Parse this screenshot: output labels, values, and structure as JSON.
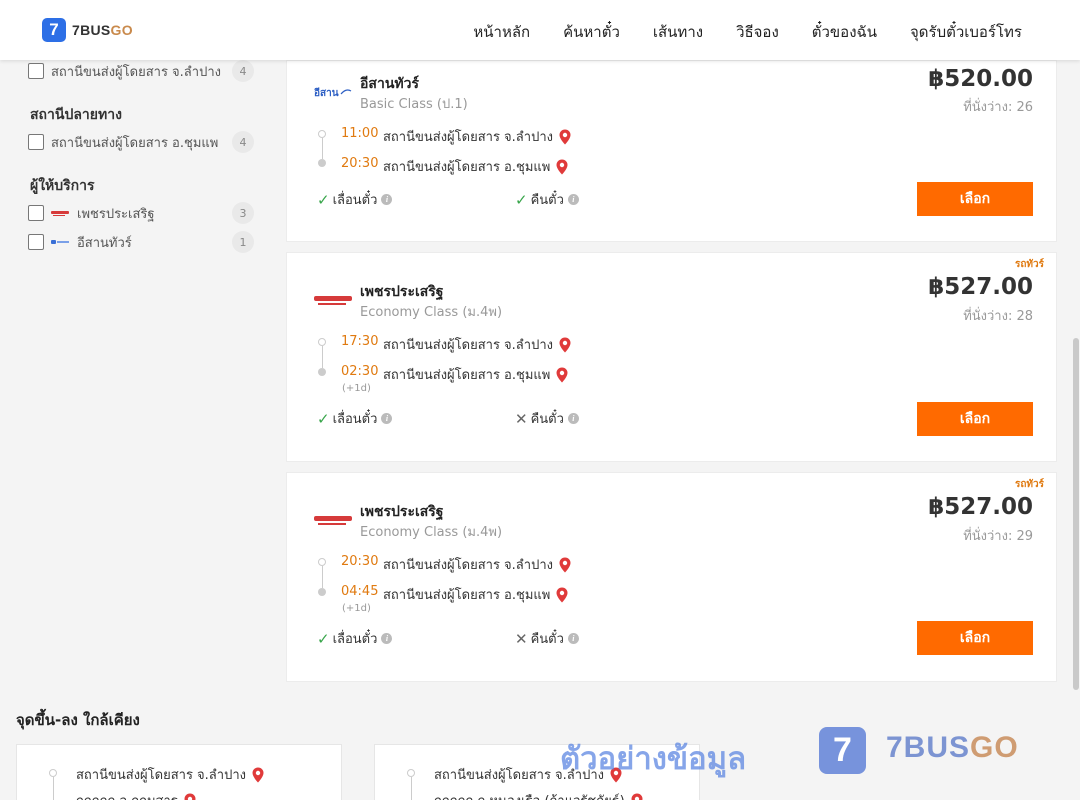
{
  "brand": {
    "logo_mark": "7",
    "name_main": "7BUS",
    "name_accent": "GO"
  },
  "nav": [
    "หน้าหลัก",
    "ค้นหาตั๋ว",
    "เส้นทาง",
    "วิธีจอง",
    "ตั๋วของฉัน",
    "จุดรับตั๋วเบอร์โทร"
  ],
  "sidebar": {
    "origin_item": {
      "label": "สถานีขนส่งผู้โดยสาร จ.ลำปาง",
      "count": "4"
    },
    "destination_title": "สถานีปลายทาง",
    "destination_item": {
      "label": "สถานีขนส่งผู้โดยสาร อ.ชุมแพ",
      "count": "4"
    },
    "operator_title": "ผู้ให้บริการ",
    "operators": [
      {
        "label": "เพชรประเสริฐ",
        "count": "3",
        "logo_color": "#d63a3a"
      },
      {
        "label": "อีสานทัวร์",
        "count": "1",
        "logo_color": "#3a6fd6"
      }
    ]
  },
  "trips": [
    {
      "operator": "อีสานทัวร์",
      "class": "Basic Class (ป.1)",
      "price": "฿520.00",
      "seats": "ที่นั่งว่าง: 26",
      "badge": "",
      "depart_time": "11:00",
      "depart_station": "สถานีขนส่งผู้โดยสาร จ.ลำปาง",
      "arrive_time": "20:30",
      "arrive_station": "สถานีขนส่งผู้โดยสาร อ.ชุมแพ",
      "next_day": "",
      "change_label": "เลื่อนตั๋ว",
      "change_allowed": true,
      "refund_label": "คืนตั๋ว",
      "refund_allowed": true,
      "button": "เลือก"
    },
    {
      "operator": "เพชรประเสริฐ",
      "class": "Economy Class (ม.4พ)",
      "price": "฿527.00",
      "seats": "ที่นั่งว่าง: 28",
      "badge": "รถทัวร์",
      "depart_time": "17:30",
      "depart_station": "สถานีขนส่งผู้โดยสาร จ.ลำปาง",
      "arrive_time": "02:30",
      "arrive_station": "สถานีขนส่งผู้โดยสาร อ.ชุมแพ",
      "next_day": "(+1d)",
      "change_label": "เลื่อนตั๋ว",
      "change_allowed": true,
      "refund_label": "คืนตั๋ว",
      "refund_allowed": false,
      "button": "เลือก"
    },
    {
      "operator": "เพชรประเสริฐ",
      "class": "Economy Class (ม.4พ)",
      "price": "฿527.00",
      "seats": "ที่นั่งว่าง: 29",
      "badge": "รถทัวร์",
      "depart_time": "20:30",
      "depart_station": "สถานีขนส่งผู้โดยสาร จ.ลำปาง",
      "arrive_time": "04:45",
      "arrive_station": "สถานีขนส่งผู้โดยสาร อ.ชุมแพ",
      "next_day": "(+1d)",
      "change_label": "เลื่อนตั๋ว",
      "change_allowed": true,
      "refund_label": "คืนตั๋ว",
      "refund_allowed": false,
      "button": "เลือก"
    }
  ],
  "icons": {
    "check": "check-icon",
    "cross": "cross-icon",
    "info": "info-icon",
    "pin": "map-pin-icon"
  },
  "nearby": {
    "title": "จุดขึ้น-ลง ใกล้เคียง",
    "cards": [
      {
        "from": "สถานีขนส่งผู้โดยสาร จ.ลำปาง",
        "to": "ถถถถถ จ.ถถมสาร"
      },
      {
        "from": "สถานีขนส่งผู้โดยสาร จ.ลำปาง",
        "to": "ถถถถถ ถ.หนองเรือ (ถ้าแวรัชถัยธ์)"
      }
    ]
  },
  "watermark": {
    "text": "ตัวอย่างข้อมูล",
    "logo_mark": "7",
    "brand_main": "7BUS",
    "brand_accent": "GO"
  },
  "colors": {
    "accent": "#ff6a00",
    "time": "#e07a10",
    "brand_blue": "#2d6fe6",
    "check": "#3aa64c",
    "pin": "#e03a3a"
  }
}
